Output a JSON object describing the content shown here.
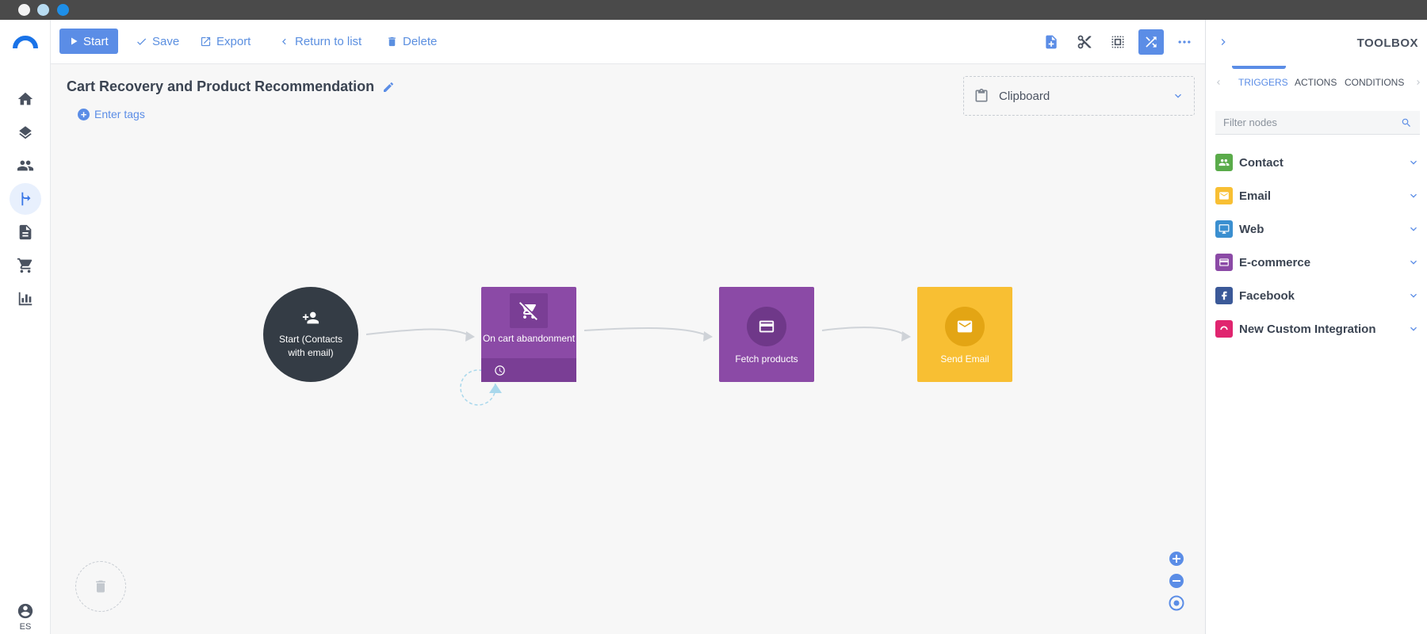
{
  "toolbar": {
    "start_label": "Start",
    "save_label": "Save",
    "export_label": "Export",
    "return_label": "Return to list",
    "delete_label": "Delete"
  },
  "workflow": {
    "title": "Cart Recovery and Product Recommendation",
    "tags_label": "Enter tags"
  },
  "clipboard": {
    "label": "Clipboard"
  },
  "nodes": {
    "start": "Start (Contacts with email)",
    "cart": "On cart abandonment",
    "fetch": "Fetch products",
    "email": "Send Email"
  },
  "sidebar": {
    "language": "ES"
  },
  "toolbox": {
    "title": "TOOLBOX",
    "tabs": [
      "TRIGGERS",
      "ACTIONS",
      "CONDITIONS"
    ],
    "active_tab": "TRIGGERS",
    "filter_placeholder": "Filter nodes",
    "categories": [
      {
        "label": "Contact",
        "icon": "contacts-icon",
        "color": "#5aab4a"
      },
      {
        "label": "Email",
        "icon": "mail-icon",
        "color": "#f8bf33"
      },
      {
        "label": "Web",
        "icon": "monitor-icon",
        "color": "#3a8fd0"
      },
      {
        "label": "E-commerce",
        "icon": "card-icon",
        "color": "#8b4aa6"
      },
      {
        "label": "Facebook",
        "icon": "facebook-icon",
        "color": "#3b5998"
      },
      {
        "label": "New Custom Integration",
        "icon": "integration-icon",
        "color": "#e0256f"
      }
    ]
  },
  "colors": {
    "accent": "#5b8de6",
    "start_node": "#343c45",
    "purple_node": "#8b4aa6",
    "yellow_node": "#f8bf33"
  }
}
